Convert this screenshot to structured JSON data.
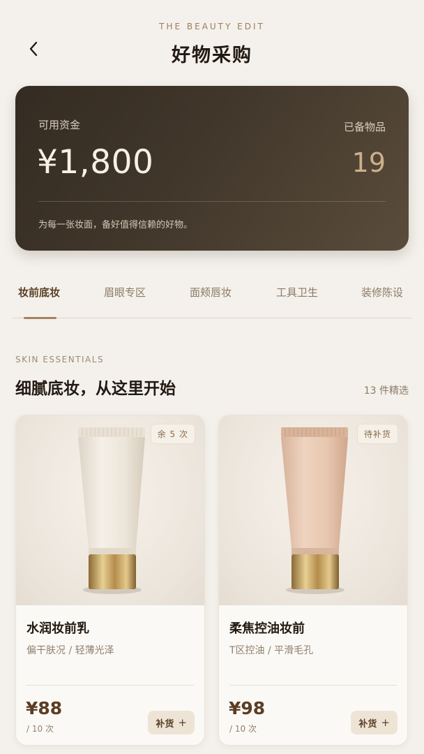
{
  "header": {
    "eyebrow": "THE BEAUTY EDIT",
    "title": "好物采购",
    "back_icon": "chevron-left-icon"
  },
  "balance": {
    "funds_label": "可用资金",
    "funds_value": "¥1,800",
    "items_label": "已备物品",
    "items_value": "19",
    "tagline": "为每一张妆面，备好值得信赖的好物。"
  },
  "tabs": [
    {
      "label": "妆前底妆",
      "active": true
    },
    {
      "label": "眉眼专区",
      "active": false
    },
    {
      "label": "面颊唇妆",
      "active": false
    },
    {
      "label": "工具卫生",
      "active": false
    },
    {
      "label": "装修陈设",
      "active": false
    }
  ],
  "section": {
    "eyebrow": "SKIN ESSENTIALS",
    "title": "细腻底妆，从这里开始",
    "count": "13 件精选"
  },
  "products": [
    {
      "badge": "余 5 次",
      "name": "水润妆前乳",
      "desc": "偏干肤况 / 轻薄光泽",
      "price": "¥88",
      "unit": "/ 10 次",
      "button": "补货",
      "button_icon": "plus-icon",
      "tube_color": "#ede6da"
    },
    {
      "badge": "待补货",
      "name": "柔焦控油妆前",
      "desc": "T区控油 / 平滑毛孔",
      "price": "¥98",
      "unit": "/ 10 次",
      "button": "补货",
      "button_icon": "plus-icon",
      "tube_color": "#e7c7b0"
    }
  ],
  "colors": {
    "accent": "#5a3f25",
    "card_dark": "#3a3026",
    "background": "#f4f1ec"
  }
}
